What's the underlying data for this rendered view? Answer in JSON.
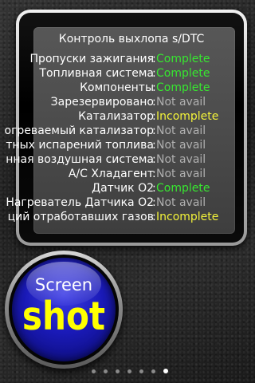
{
  "panel": {
    "title": "Контроль выхлопа s/DTC",
    "rows": [
      {
        "label": "Пропуски зажигания",
        "status": "Complete",
        "state": "complete"
      },
      {
        "label": "Топливная система",
        "status": "Complete",
        "state": "complete"
      },
      {
        "label": "Компоненты",
        "status": "Complete",
        "state": "complete"
      },
      {
        "label": "Зарезервировано",
        "status": "Not avail",
        "state": "na"
      },
      {
        "label": "Катализатор",
        "status": "Incomplete",
        "state": "incomplete"
      },
      {
        "label": "огреваемый катализатор",
        "status": "Not avail",
        "state": "na"
      },
      {
        "label": "тных испарений топлива",
        "status": "Not avail",
        "state": "na"
      },
      {
        "label": "нная воздушная система",
        "status": "Not avail",
        "state": "na"
      },
      {
        "label": "A/C Хладагент",
        "status": "Not avail",
        "state": "na"
      },
      {
        "label": "Датчик O2",
        "status": "Complete",
        "state": "complete"
      },
      {
        "label": "Нагреватель Датчика O2",
        "status": "Not avail",
        "state": "na"
      },
      {
        "label": "ций отработавших газов",
        "status": "Incomplete",
        "state": "incomplete"
      }
    ]
  },
  "badge": {
    "top_text": "Screen",
    "bottom_text": "shot"
  },
  "pager": {
    "count": 7,
    "active_index": 6
  },
  "colors": {
    "complete": "#37e630",
    "incomplete": "#f2f23a",
    "not_avail": "#b0b0b0",
    "badge_blue": "#1a1ab8",
    "badge_text": "#ffff00"
  }
}
